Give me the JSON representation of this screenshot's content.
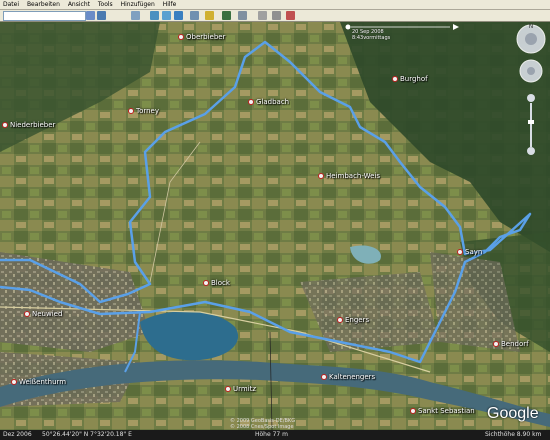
{
  "menu": [
    "Datei",
    "Bearbeiten",
    "Ansicht",
    "Tools",
    "Hinzufügen",
    "Hilfe"
  ],
  "search": {
    "value": ""
  },
  "colors": {
    "track": "#5aa0e8",
    "menubar": "#ece9d8"
  },
  "toolbar_icons": [
    "hide-sidebar-icon",
    "placemark-icon",
    "polygon-icon",
    "path-icon",
    "overlay-icon",
    "record-tour-icon",
    "historical-imagery-icon",
    "sun-icon",
    "switch-to-sky-icon",
    "ruler-icon",
    "email-icon",
    "print-icon",
    "maps-icon"
  ],
  "time_slider": {
    "date": "20 Sep 2008",
    "time": "8:43vormittags"
  },
  "nav": {
    "north": "N"
  },
  "places": [
    {
      "name": "Oberbieber"
    },
    {
      "name": "Torney"
    },
    {
      "name": "Niederbieber"
    },
    {
      "name": "Gladbach"
    },
    {
      "name": "Burghof"
    },
    {
      "name": "Heimbach-Weis"
    },
    {
      "name": "Sayn"
    },
    {
      "name": "Block"
    },
    {
      "name": "Neuwied"
    },
    {
      "name": "Engers"
    },
    {
      "name": "Bendorf"
    },
    {
      "name": "Weißenthurm"
    },
    {
      "name": "Urmitz"
    },
    {
      "name": "Kaltenengers"
    },
    {
      "name": "Sankt Sebastian"
    }
  ],
  "copyright": {
    "line1": "© 2009 GeoBasis-DE/BKG",
    "line2": "© 2008 Cnes/Spot Image"
  },
  "status": {
    "left": "Dez 2006",
    "coords": "50°26.44'20\" N 7°32'20.18\" E",
    "elevation": "Höhe 77 m",
    "eye": "Sichthöhe 8.90 km"
  },
  "logo": "Google"
}
